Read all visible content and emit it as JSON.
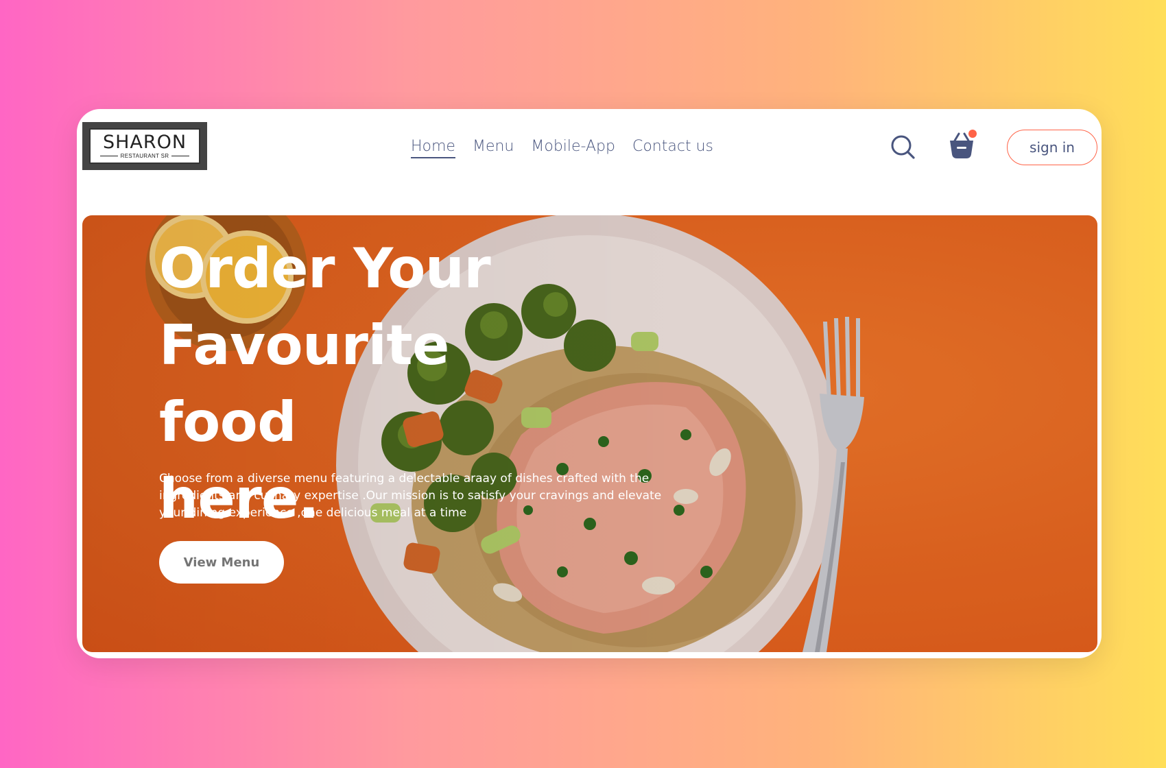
{
  "brand": {
    "logo_word": "SHARON",
    "logo_tagline": "RESTAURANT SR"
  },
  "nav": {
    "items": [
      {
        "label": "Home",
        "active": true
      },
      {
        "label": "Menu",
        "active": false
      },
      {
        "label": "Mobile-App",
        "active": false
      },
      {
        "label": "Contact us",
        "active": false
      }
    ]
  },
  "header": {
    "search_icon": "search-icon",
    "cart_icon": "basket-icon",
    "cart_has_items": true,
    "signin_label": "sign in"
  },
  "hero": {
    "title_lines": [
      "Order Your",
      "Favourite food",
      "here."
    ],
    "description": "Choose from a diverse menu featuring a delectable araay of dishes crafted with the ingredients and culinary expertise .Our mission is to satisfy your cravings and elevate your dining experience ,one delicious meal at a time",
    "cta_label": "View Menu"
  },
  "colors": {
    "accent": "#ff6347",
    "nav_text": "#49557e",
    "hero_bg": "#ec6a22"
  }
}
